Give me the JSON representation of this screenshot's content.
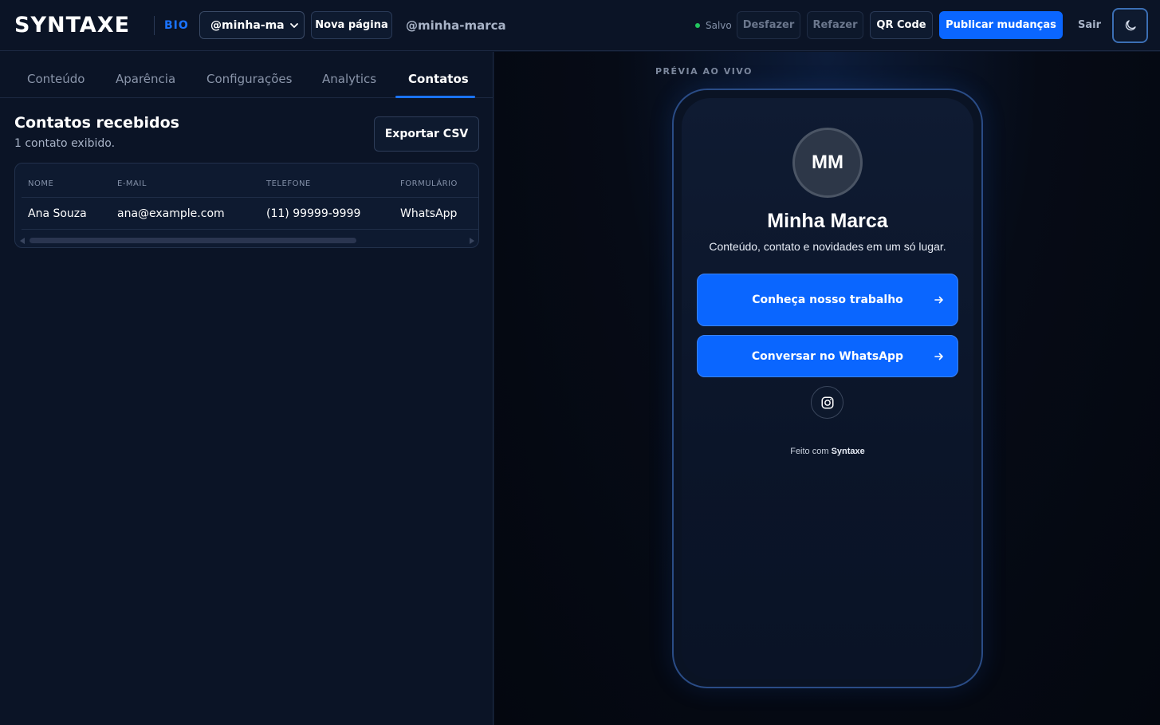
{
  "header": {
    "logo": "SYNTAXE",
    "logo_sub": "BIO",
    "page_select": "@minha-marca",
    "new_page": "Nova página",
    "handle": "@minha-marca",
    "saved": "Salvo",
    "undo": "Desfazer",
    "redo": "Refazer",
    "qr": "QR Code",
    "publish": "Publicar mudanças",
    "logout": "Sair"
  },
  "tabs": [
    {
      "label": "Conteúdo"
    },
    {
      "label": "Aparência"
    },
    {
      "label": "Configurações"
    },
    {
      "label": "Analytics"
    },
    {
      "label": "Contatos"
    }
  ],
  "contacts": {
    "title": "Contatos recebidos",
    "subtitle": "1 contato exibido.",
    "export": "Exportar CSV",
    "columns": [
      "NOME",
      "E-MAIL",
      "TELEFONE",
      "FORMULÁRIO"
    ],
    "rows": [
      [
        "Ana Souza",
        "ana@example.com",
        "(11) 99999-9999",
        "WhatsApp"
      ]
    ]
  },
  "preview": {
    "label": "PRÉVIA AO VIVO",
    "initials": "MM",
    "name": "Minha Marca",
    "description": "Conteúdo, contato e novidades em um só lugar.",
    "buttons": [
      {
        "label": "Conheça nosso trabalho"
      },
      {
        "label": "Conversar no WhatsApp"
      }
    ],
    "made_with_prefix": "Feito com",
    "made_with_brand": "Syntaxe"
  },
  "colors": {
    "accent": "#0a66ff",
    "background": "#0b1426",
    "saved_dot": "#22c55e"
  },
  "icons": {
    "select": "chevron-down-icon",
    "theme": "moon-icon",
    "link_arrow": "arrow-right-icon",
    "social": "instagram-icon"
  }
}
